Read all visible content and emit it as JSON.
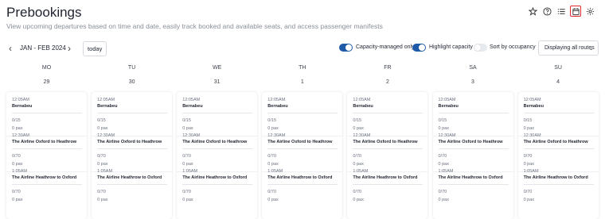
{
  "header": {
    "title": "Prebookings",
    "subtitle": "View upcoming departures based on time and date, easily track booked and available seats, and access passenger manifests"
  },
  "top_icons": [
    "star-icon",
    "help-icon",
    "list-icon",
    "calendar-icon",
    "gear-icon"
  ],
  "toolbar": {
    "date_range": "JAN - FEB 2024",
    "today_label": "today",
    "toggles": [
      {
        "label": "Capacity-managed only",
        "on": true
      },
      {
        "label": "Highlight capacity",
        "on": true
      },
      {
        "label": "Sort by occupancy",
        "on": false
      }
    ],
    "routes_select": "Displaying all routes"
  },
  "colors": {
    "accent": "#1f5aa8",
    "active_icon_border": "#e0282e"
  },
  "days": [
    {
      "dow": "MO",
      "date": "29"
    },
    {
      "dow": "TU",
      "date": "30"
    },
    {
      "dow": "WE",
      "date": "31"
    },
    {
      "dow": "TH",
      "date": "1"
    },
    {
      "dow": "FR",
      "date": "2"
    },
    {
      "dow": "SA",
      "date": "3"
    },
    {
      "dow": "SU",
      "date": "4"
    }
  ],
  "entries": [
    {
      "time": "12:05AM",
      "route": "Bernabeu",
      "seats": "0/15",
      "pax": "0 pax"
    },
    {
      "time": "12:30AM",
      "route": "The Airline Oxford to Heathrow",
      "seats": "0/70",
      "pax": "0 pax"
    },
    {
      "time": "1:05AM",
      "route": "The Airline Heathrow to Oxford",
      "seats": "0/70",
      "pax": "0 pax"
    }
  ]
}
